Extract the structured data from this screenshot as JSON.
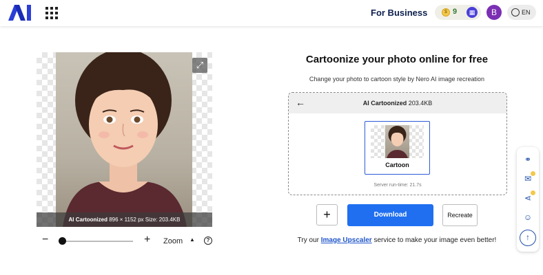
{
  "header": {
    "logo": "AI",
    "business_link": "For Business",
    "credits": "9",
    "avatar_initial": "B",
    "language": "EN"
  },
  "viewer": {
    "caption_bold": "AI Cartoonized",
    "caption_rest": "896 × 1152 px  Size: 203.4KB",
    "zoom_label": "Zoom"
  },
  "panel": {
    "title": "Cartoonize your photo online for free",
    "subtitle": "Change your photo to cartoon style by Nero AI image recreation",
    "card_title_bold": "AI Cartoonized",
    "card_title_size": "203.4KB",
    "thumb_label": "Cartoon",
    "runtime": "Server run-time: 21.7s"
  },
  "actions": {
    "plus": "+",
    "download": "Download",
    "recreate": "Recreate"
  },
  "promo": {
    "prefix": "Try our",
    "link": "Image Upscaler",
    "suffix": "service to make your image even better!"
  },
  "colors": {
    "accent": "#1f6ff0",
    "brand": "#2b3fd6"
  }
}
